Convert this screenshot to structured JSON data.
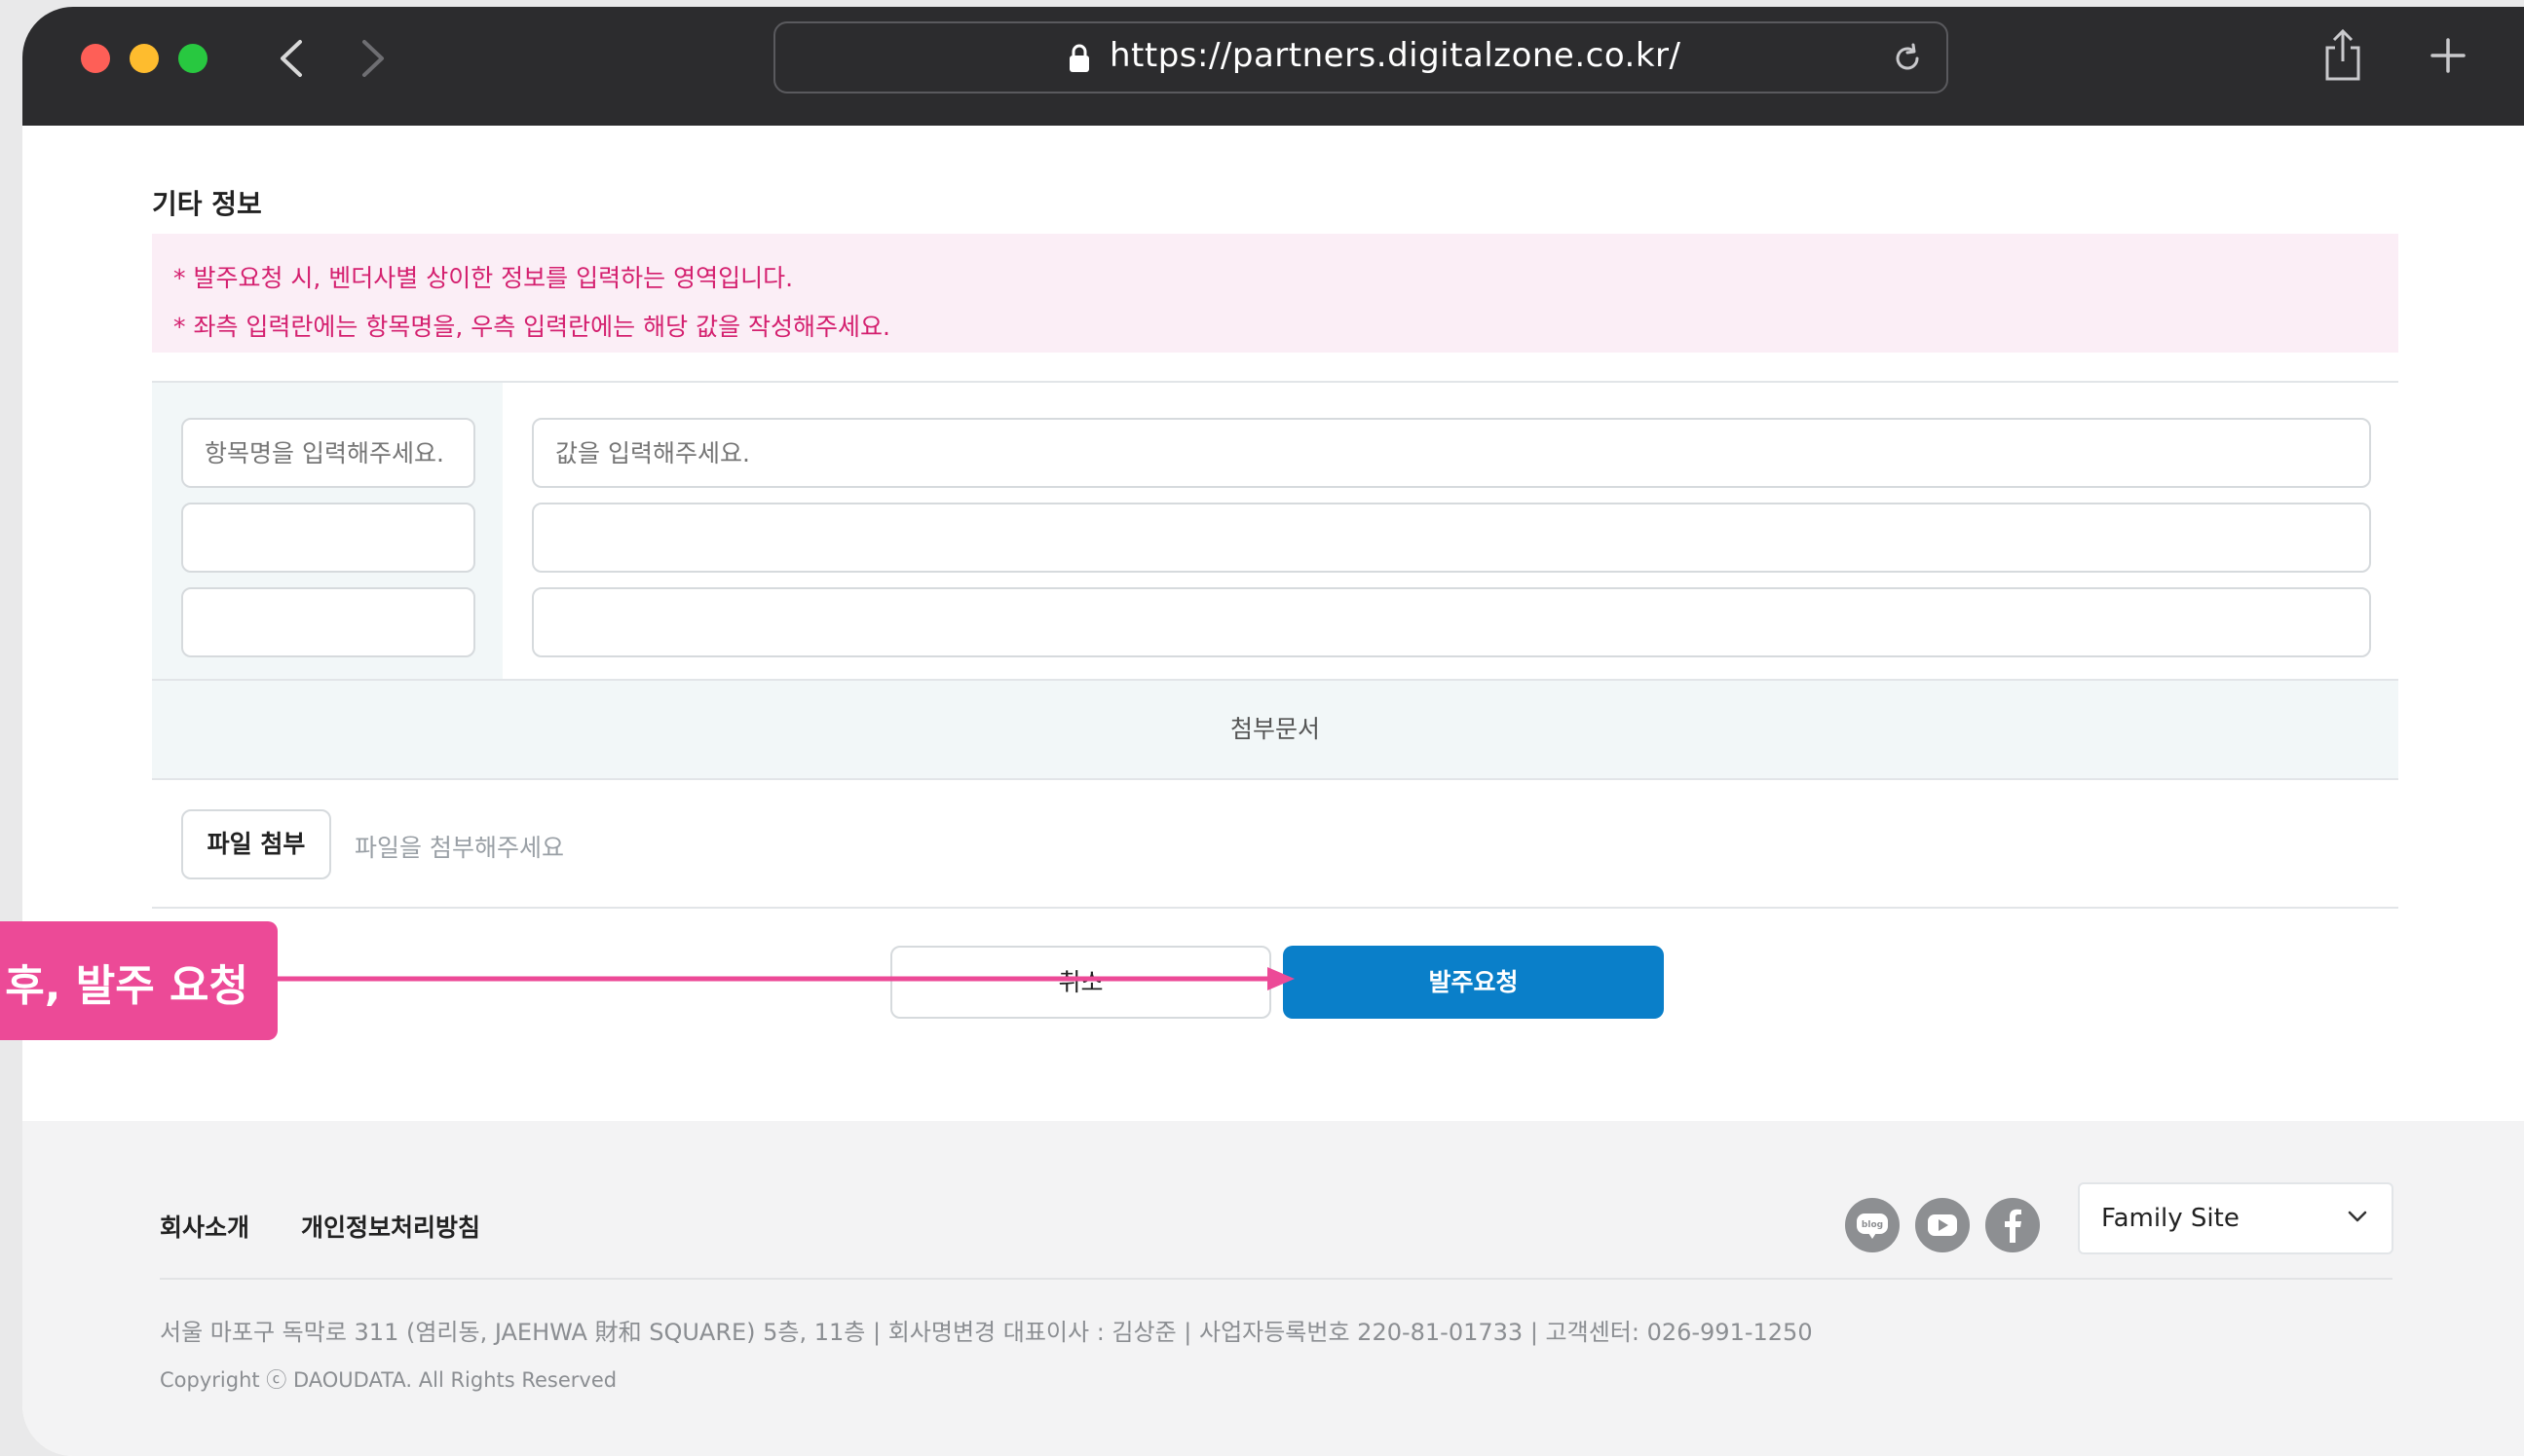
{
  "browser": {
    "url": "https://partners.digitalzone.co.kr/",
    "icons": [
      "back-icon",
      "forward-icon",
      "lock-icon",
      "reload-icon",
      "share-icon",
      "new-tab-icon"
    ]
  },
  "section": {
    "title": "기타 정보",
    "notices": [
      "* 발주요청 시, 벤더사별 상이한 정보를 입력하는 영역입니다.",
      "* 좌측 입력란에는 항목명을, 우측 입력란에는 해당 값을 작성해주세요."
    ]
  },
  "fields": {
    "name_placeholder": "항목명을 입력해주세요.",
    "value_placeholder": "값을 입력해주세요.",
    "rows": [
      {
        "name": "",
        "value": ""
      },
      {
        "name": "",
        "value": ""
      },
      {
        "name": "",
        "value": ""
      }
    ]
  },
  "attachment": {
    "header": "첨부문서",
    "button_label": "파일 첨부",
    "hint": "파일을 첨부해주세요"
  },
  "actions": {
    "cancel_label": "취소",
    "submit_label": "발주요청"
  },
  "footer": {
    "links": [
      "회사소개",
      "개인정보처리방침"
    ],
    "social_icons": [
      "blog-icon",
      "youtube-icon",
      "facebook-icon"
    ],
    "family_site_label": "Family Site",
    "address": "서울 마포구 독막로 311 (염리동, JAEHWA 財和 SQUARE) 5층, 11층  |  회사명변경 대표이사 : 김상준  |  사업자등록번호 220-81-01733  |  고객센터: 026-991-1250",
    "copyright": "Copyright ⓒ DAOUDATA. All Rights Reserved"
  },
  "annotation": {
    "text": "후, 발주 요청",
    "color": "#ec4a97"
  },
  "colors": {
    "primary": "#0a7fc9",
    "notice_text": "#d4206f",
    "notice_bg": "#fbeef6"
  }
}
